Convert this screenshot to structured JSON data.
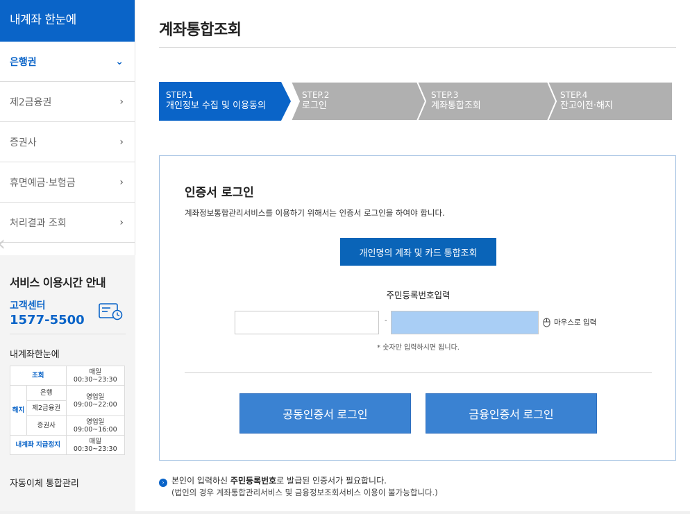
{
  "sidebar": {
    "title": "내계좌 한눈에",
    "items": [
      {
        "label": "은행권",
        "chevron": "⌄"
      },
      {
        "label": "제2금융권",
        "chevron": "›"
      },
      {
        "label": "증권사",
        "chevron": "›"
      },
      {
        "label": "휴면예금·보험금",
        "chevron": "›"
      },
      {
        "label": "처리결과 조회",
        "chevron": "›"
      }
    ],
    "service": {
      "title": "서비스 이용시간 안내",
      "center_label": "고객센터",
      "phone": "1577-5500",
      "subtitle": "내계좌한눈에",
      "table": {
        "inquiry_label": "조회",
        "inquiry_time_1": "매일",
        "inquiry_time_2": "00:30~23:30",
        "cancel_label": "해지",
        "bank_label": "은행",
        "second_label": "제2금융권",
        "bank_time_1": "영업일",
        "bank_time_2": "09:00~22:00",
        "securities_label": "증권사",
        "securities_time_1": "영업일",
        "securities_time_2": "09:00~16:00",
        "stop_label": "내계좌 지급정지",
        "stop_time_1": "매일",
        "stop_time_2": "00:30~23:30"
      },
      "bottom_label": "자동이체 통합관리"
    }
  },
  "main": {
    "title": "계좌통합조회",
    "steps": [
      {
        "num": "STEP.1",
        "label": "개인정보 수집 및 이용동의"
      },
      {
        "num": "STEP.2",
        "label": "로그인"
      },
      {
        "num": "STEP.3",
        "label": "계좌통합조회"
      },
      {
        "num": "STEP.4",
        "label": "잔고이전·해지"
      }
    ],
    "box": {
      "title": "인증서 로그인",
      "description": "계좌정보통합관리서비스를 이용하기 위해서는 인증서 로그인을 하여야 합니다.",
      "combined_button": "개인명의 계좌 및 카드 통합조회",
      "rrn_label": "주민등록번호입력",
      "rrn_dash": "-",
      "mouse_label": "마우스로 입력",
      "hint": "* 숫자만 입력하시면 됩니다.",
      "login_button_1": "공동인증서 로그인",
      "login_button_2": "금융인증서 로그인"
    },
    "note": {
      "line1_prefix": "본인이 입력하신 ",
      "line1_strong": "주민등록번호",
      "line1_suffix": "로 발급된 인증서가 필요합니다.",
      "line2": "(법인의 경우 계좌통합관리서비스 및 금융정보조회서비스 이용이 불가능합니다.)"
    }
  },
  "colors": {
    "primary": "#0a64c8",
    "step_active": "#0a64c8",
    "step_inactive": "#b0b0b0",
    "login_button": "#3a82d2",
    "rrn_highlight": "#a9cef5"
  }
}
